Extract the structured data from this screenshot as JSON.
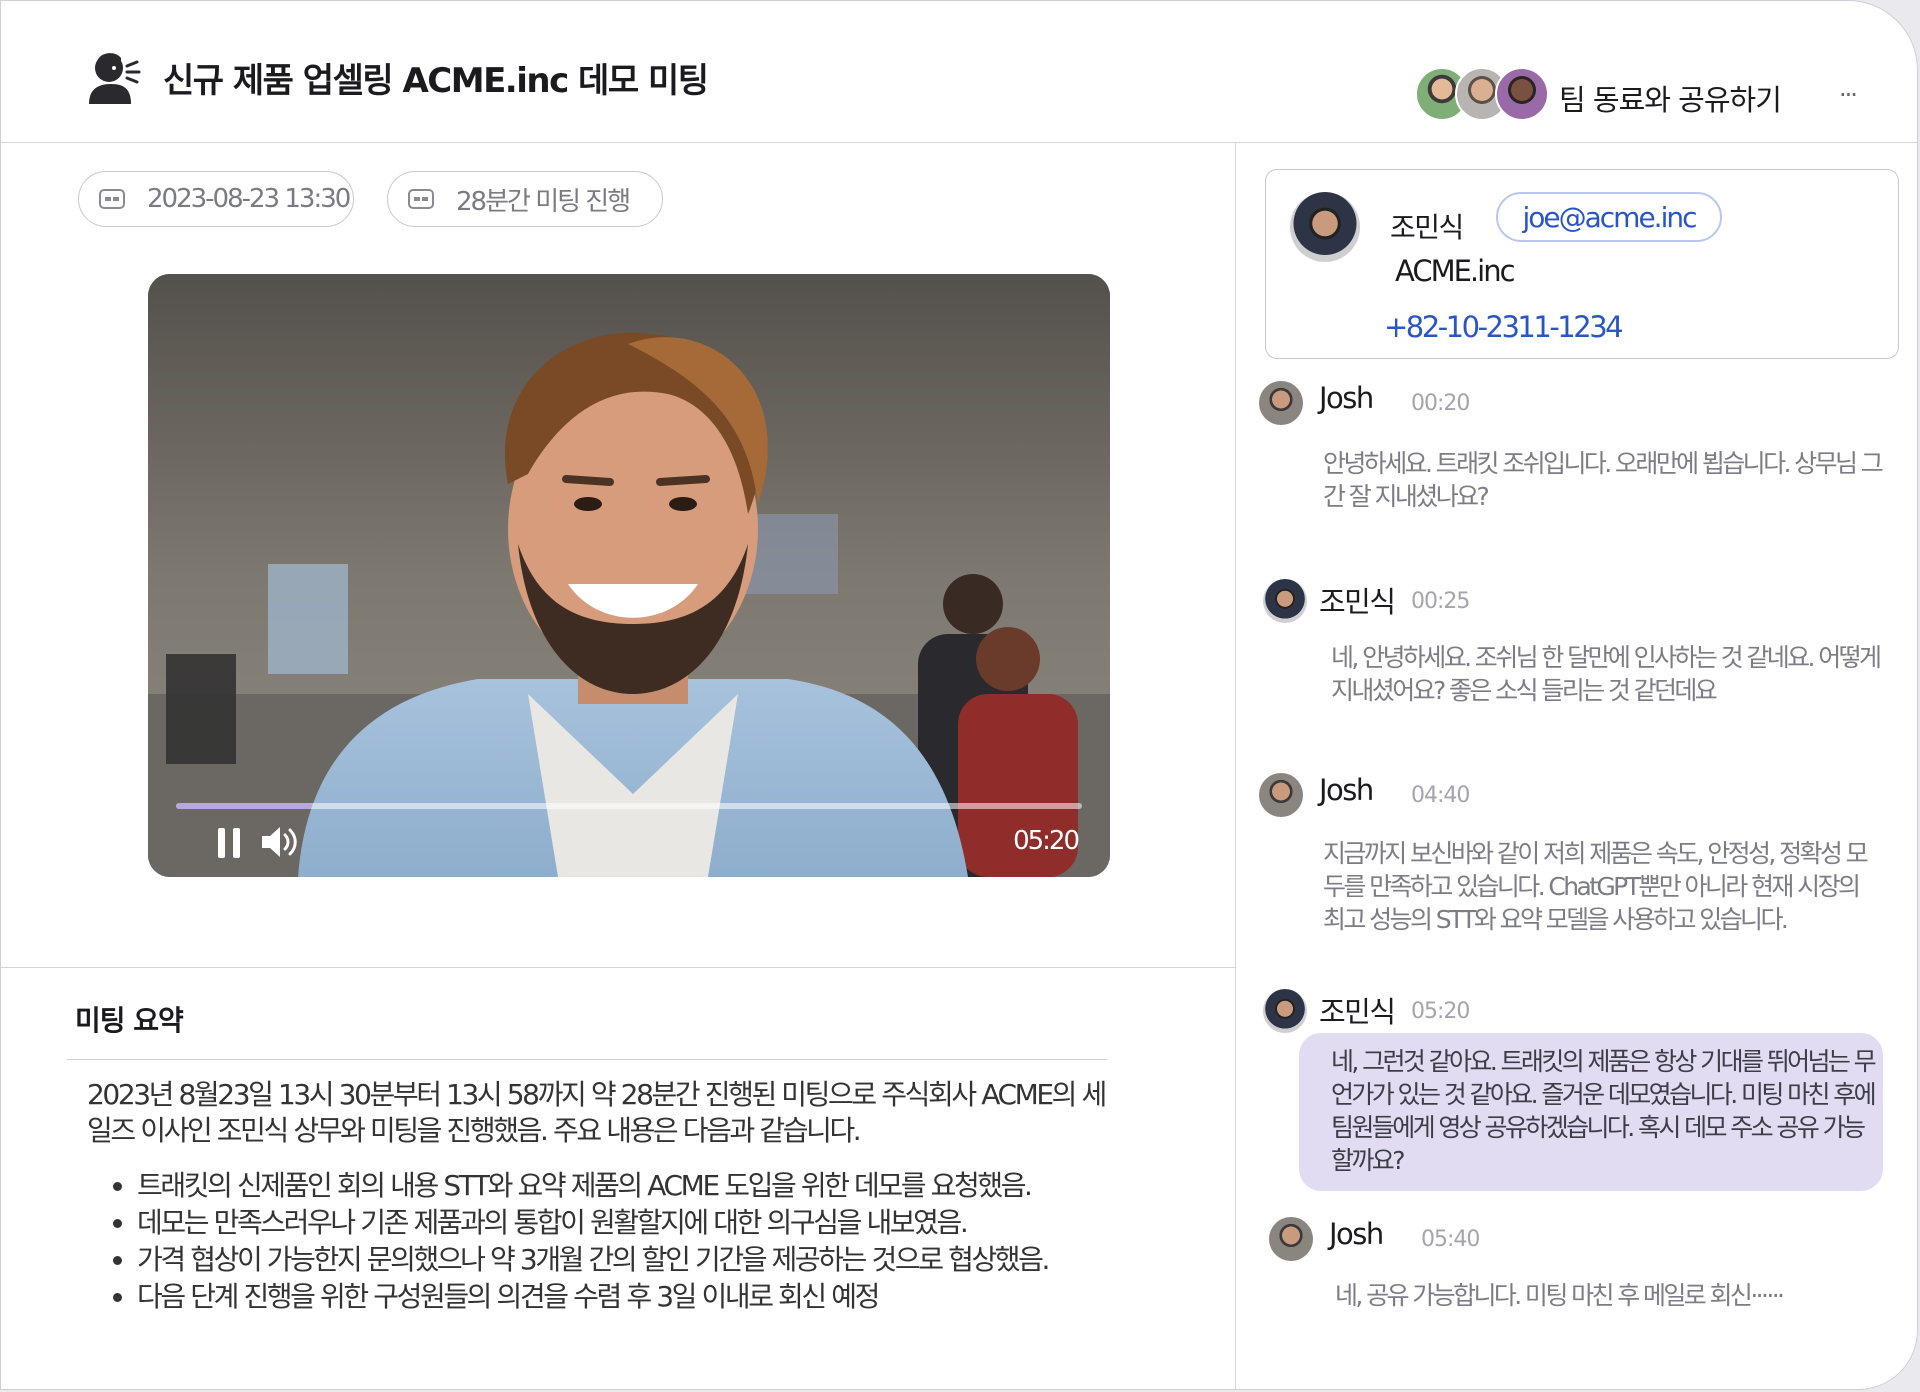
{
  "header": {
    "title": "신규 제품 업셀링 ACME.inc 데모 미팅",
    "share_label": "팀 동료와 공유하기",
    "more_label": "···"
  },
  "meta": {
    "datetime": "2023-08-23 13:30",
    "duration": "28분간 미팅 진행"
  },
  "video": {
    "time": "05:20",
    "progress": 0.15
  },
  "summary": {
    "title": "미팅 요약",
    "body": "2023년 8월23일 13시 30분부터 13시 58까지 약 28분간 진행된 미팅으로 주식회사 ACME의 세일즈 이사인 조민식 상무와 미팅을 진행했음. 주요 내용은 다음과 같습니다.",
    "bullets": [
      "트래킷의 신제품인 회의 내용 STT와 요약 제품의 ACME 도입을 위한 데모를 요청했음.",
      "데모는 만족스러우나 기존 제품과의 통합이 원활할지에 대한 의구심을 내보였음.",
      "가격 협상이 가능한지 문의했으나 약 3개월 간의 할인 기간을 제공하는 것으로 협상했음.",
      "다음 단계 진행을 위한 구성원들의 의견을 수렴 후 3일 이내로 회신 예정"
    ]
  },
  "contact": {
    "name": "조민식",
    "email": "joe@acme.inc",
    "company": "ACME.inc",
    "phone": "+82-10-2311-1234"
  },
  "transcript": [
    {
      "speaker": "Josh",
      "time": "00:20",
      "text": "안녕하세요. 트래킷 조쉬입니다. 오래만에 뵙습니다. 상무님 그간 잘 지내셨나요?"
    },
    {
      "speaker": "조민식",
      "time": "00:25",
      "text": "네, 안녕하세요. 조쉬님 한 달만에 인사하는 것 같네요. 어떻게 지내셨어요? 좋은 소식 들리는 것 같던데요"
    },
    {
      "speaker": "Josh",
      "time": "04:40",
      "text": "지금까지 보신바와 같이 저희 제품은 속도, 안정성, 정확성 모두를 만족하고 있습니다. ChatGPT뿐만 아니라 현재 시장의 최고 성능의 STT와 요약 모델을 사용하고 있습니다."
    },
    {
      "speaker": "조민식",
      "time": "05:20",
      "text": "네, 그런것 같아요. 트래킷의 제품은 항상 기대를 뛰어넘는 무언가가 있는 것 같아요. 즐거운 데모였습니다. 미팅 마친 후에 팀원들에게 영상 공유하겠습니다. 혹시 데모 주소 공유 가능할까요?"
    },
    {
      "speaker": "Josh",
      "time": "05:40",
      "text": "네, 공유 가능합니다. 미팅 마친 후 메일로 회신······"
    }
  ],
  "colors": {
    "accent": "#2a55c9",
    "bubble": "#e2dcf3",
    "progress": "#b7a6e3"
  }
}
